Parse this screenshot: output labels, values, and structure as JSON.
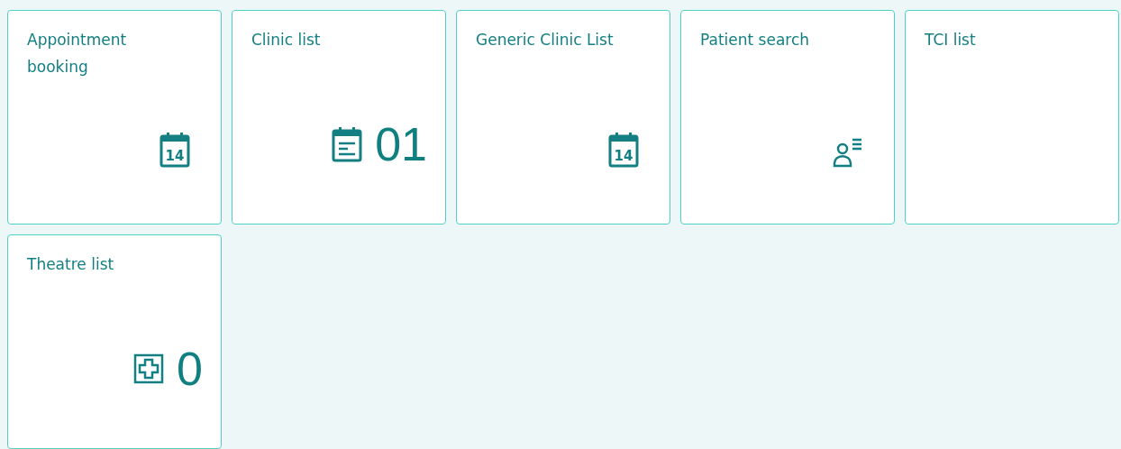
{
  "tiles": [
    {
      "title": "Appointment booking",
      "kind": "calendar-day",
      "icon_text": "14"
    },
    {
      "title": "Clinic list",
      "kind": "calendar-lines",
      "count": "01"
    },
    {
      "title": "Generic Clinic List",
      "kind": "calendar-day",
      "icon_text": "14"
    },
    {
      "title": "Patient search",
      "kind": "person-list"
    },
    {
      "title": "TCI list",
      "kind": "plain"
    },
    {
      "title": "Theatre list",
      "kind": "medical-cross",
      "count": "0"
    }
  ]
}
